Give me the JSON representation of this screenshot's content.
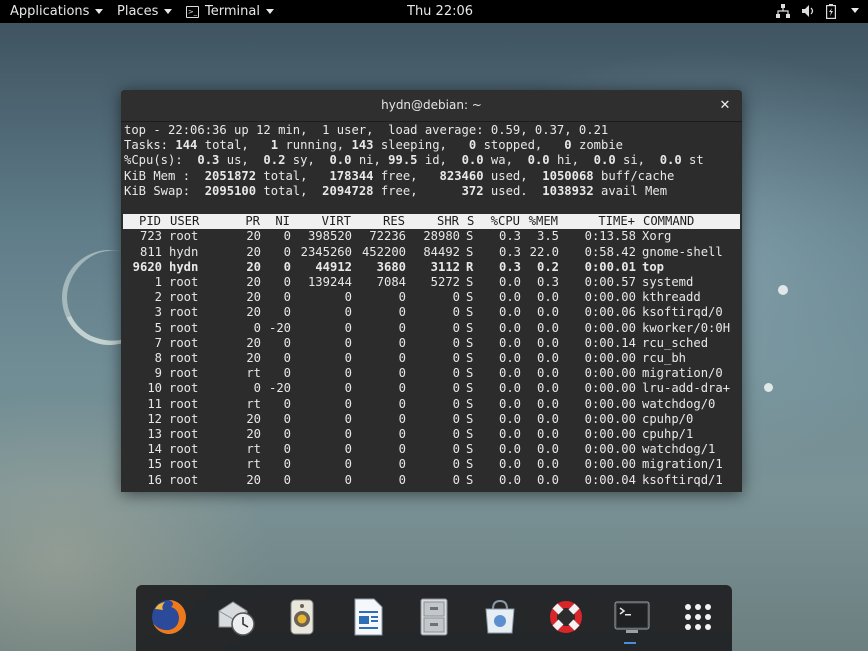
{
  "topbar": {
    "applications": "Applications",
    "places": "Places",
    "terminal": "Terminal",
    "clock": "Thu 22:06"
  },
  "window": {
    "title": "hydn@debian: ~"
  },
  "top": {
    "summary": [
      [
        {
          "t": "top - 22:06:36 up 12 min,  1 user,  load average: 0.59, 0.37, 0.21",
          "b": false
        }
      ],
      [
        {
          "t": "Tasks: ",
          "b": false
        },
        {
          "t": "144",
          "b": true
        },
        {
          "t": " total,   ",
          "b": false
        },
        {
          "t": "1",
          "b": true
        },
        {
          "t": " running, ",
          "b": false
        },
        {
          "t": "143",
          "b": true
        },
        {
          "t": " sleeping,   ",
          "b": false
        },
        {
          "t": "0",
          "b": true
        },
        {
          "t": " stopped,   ",
          "b": false
        },
        {
          "t": "0",
          "b": true
        },
        {
          "t": " zombie",
          "b": false
        }
      ],
      [
        {
          "t": "%Cpu(s):  ",
          "b": false
        },
        {
          "t": "0.3",
          "b": true
        },
        {
          "t": " us,  ",
          "b": false
        },
        {
          "t": "0.2",
          "b": true
        },
        {
          "t": " sy,  ",
          "b": false
        },
        {
          "t": "0.0",
          "b": true
        },
        {
          "t": " ni, ",
          "b": false
        },
        {
          "t": "99.5",
          "b": true
        },
        {
          "t": " id,  ",
          "b": false
        },
        {
          "t": "0.0",
          "b": true
        },
        {
          "t": " wa,  ",
          "b": false
        },
        {
          "t": "0.0",
          "b": true
        },
        {
          "t": " hi,  ",
          "b": false
        },
        {
          "t": "0.0",
          "b": true
        },
        {
          "t": " si,  ",
          "b": false
        },
        {
          "t": "0.0",
          "b": true
        },
        {
          "t": " st",
          "b": false
        }
      ],
      [
        {
          "t": "KiB Mem :  ",
          "b": false
        },
        {
          "t": "2051872",
          "b": true
        },
        {
          "t": " total,   ",
          "b": false
        },
        {
          "t": "178344",
          "b": true
        },
        {
          "t": " free,   ",
          "b": false
        },
        {
          "t": "823460",
          "b": true
        },
        {
          "t": " used,  ",
          "b": false
        },
        {
          "t": "1050068",
          "b": true
        },
        {
          "t": " buff/cache",
          "b": false
        }
      ],
      [
        {
          "t": "KiB Swap:  ",
          "b": false
        },
        {
          "t": "2095100",
          "b": true
        },
        {
          "t": " total,  ",
          "b": false
        },
        {
          "t": "2094728",
          "b": true
        },
        {
          "t": " free,      ",
          "b": false
        },
        {
          "t": "372",
          "b": true
        },
        {
          "t": " used.  ",
          "b": false
        },
        {
          "t": "1038932",
          "b": true
        },
        {
          "t": " avail Mem",
          "b": false
        }
      ]
    ],
    "columns": [
      "PID",
      "USER",
      "PR",
      "NI",
      "VIRT",
      "RES",
      "SHR",
      "S",
      "%CPU",
      "%MEM",
      "TIME+",
      "COMMAND"
    ],
    "processes": [
      {
        "pid": "723",
        "user": "root",
        "pr": "20",
        "ni": "0",
        "virt": "398520",
        "res": "72236",
        "shr": "28980",
        "s": "S",
        "cpu": "0.3",
        "mem": "3.5",
        "time": "0:13.58",
        "cmd": "Xorg",
        "bold": false
      },
      {
        "pid": "811",
        "user": "hydn",
        "pr": "20",
        "ni": "0",
        "virt": "2345260",
        "res": "452200",
        "shr": "84492",
        "s": "S",
        "cpu": "0.3",
        "mem": "22.0",
        "time": "0:58.42",
        "cmd": "gnome-shell",
        "bold": false
      },
      {
        "pid": "9620",
        "user": "hydn",
        "pr": "20",
        "ni": "0",
        "virt": "44912",
        "res": "3680",
        "shr": "3112",
        "s": "R",
        "cpu": "0.3",
        "mem": "0.2",
        "time": "0:00.01",
        "cmd": "top",
        "bold": true
      },
      {
        "pid": "1",
        "user": "root",
        "pr": "20",
        "ni": "0",
        "virt": "139244",
        "res": "7084",
        "shr": "5272",
        "s": "S",
        "cpu": "0.0",
        "mem": "0.3",
        "time": "0:00.57",
        "cmd": "systemd",
        "bold": false
      },
      {
        "pid": "2",
        "user": "root",
        "pr": "20",
        "ni": "0",
        "virt": "0",
        "res": "0",
        "shr": "0",
        "s": "S",
        "cpu": "0.0",
        "mem": "0.0",
        "time": "0:00.00",
        "cmd": "kthreadd",
        "bold": false
      },
      {
        "pid": "3",
        "user": "root",
        "pr": "20",
        "ni": "0",
        "virt": "0",
        "res": "0",
        "shr": "0",
        "s": "S",
        "cpu": "0.0",
        "mem": "0.0",
        "time": "0:00.06",
        "cmd": "ksoftirqd/0",
        "bold": false
      },
      {
        "pid": "5",
        "user": "root",
        "pr": "0",
        "ni": "-20",
        "virt": "0",
        "res": "0",
        "shr": "0",
        "s": "S",
        "cpu": "0.0",
        "mem": "0.0",
        "time": "0:00.00",
        "cmd": "kworker/0:0H",
        "bold": false
      },
      {
        "pid": "7",
        "user": "root",
        "pr": "20",
        "ni": "0",
        "virt": "0",
        "res": "0",
        "shr": "0",
        "s": "S",
        "cpu": "0.0",
        "mem": "0.0",
        "time": "0:00.14",
        "cmd": "rcu_sched",
        "bold": false
      },
      {
        "pid": "8",
        "user": "root",
        "pr": "20",
        "ni": "0",
        "virt": "0",
        "res": "0",
        "shr": "0",
        "s": "S",
        "cpu": "0.0",
        "mem": "0.0",
        "time": "0:00.00",
        "cmd": "rcu_bh",
        "bold": false
      },
      {
        "pid": "9",
        "user": "root",
        "pr": "rt",
        "ni": "0",
        "virt": "0",
        "res": "0",
        "shr": "0",
        "s": "S",
        "cpu": "0.0",
        "mem": "0.0",
        "time": "0:00.00",
        "cmd": "migration/0",
        "bold": false
      },
      {
        "pid": "10",
        "user": "root",
        "pr": "0",
        "ni": "-20",
        "virt": "0",
        "res": "0",
        "shr": "0",
        "s": "S",
        "cpu": "0.0",
        "mem": "0.0",
        "time": "0:00.00",
        "cmd": "lru-add-dra+",
        "bold": false
      },
      {
        "pid": "11",
        "user": "root",
        "pr": "rt",
        "ni": "0",
        "virt": "0",
        "res": "0",
        "shr": "0",
        "s": "S",
        "cpu": "0.0",
        "mem": "0.0",
        "time": "0:00.00",
        "cmd": "watchdog/0",
        "bold": false
      },
      {
        "pid": "12",
        "user": "root",
        "pr": "20",
        "ni": "0",
        "virt": "0",
        "res": "0",
        "shr": "0",
        "s": "S",
        "cpu": "0.0",
        "mem": "0.0",
        "time": "0:00.00",
        "cmd": "cpuhp/0",
        "bold": false
      },
      {
        "pid": "13",
        "user": "root",
        "pr": "20",
        "ni": "0",
        "virt": "0",
        "res": "0",
        "shr": "0",
        "s": "S",
        "cpu": "0.0",
        "mem": "0.0",
        "time": "0:00.00",
        "cmd": "cpuhp/1",
        "bold": false
      },
      {
        "pid": "14",
        "user": "root",
        "pr": "rt",
        "ni": "0",
        "virt": "0",
        "res": "0",
        "shr": "0",
        "s": "S",
        "cpu": "0.0",
        "mem": "0.0",
        "time": "0:00.00",
        "cmd": "watchdog/1",
        "bold": false
      },
      {
        "pid": "15",
        "user": "root",
        "pr": "rt",
        "ni": "0",
        "virt": "0",
        "res": "0",
        "shr": "0",
        "s": "S",
        "cpu": "0.0",
        "mem": "0.0",
        "time": "0:00.00",
        "cmd": "migration/1",
        "bold": false
      },
      {
        "pid": "16",
        "user": "root",
        "pr": "20",
        "ni": "0",
        "virt": "0",
        "res": "0",
        "shr": "0",
        "s": "S",
        "cpu": "0.0",
        "mem": "0.0",
        "time": "0:00.04",
        "cmd": "ksoftirqd/1",
        "bold": false
      }
    ]
  },
  "dock": {
    "items": [
      {
        "name": "firefox-icon"
      },
      {
        "name": "evolution-icon"
      },
      {
        "name": "rhythmbox-icon"
      },
      {
        "name": "libreoffice-writer-icon"
      },
      {
        "name": "files-icon"
      },
      {
        "name": "software-icon"
      },
      {
        "name": "help-icon"
      },
      {
        "name": "terminal-icon"
      },
      {
        "name": "show-applications-icon"
      }
    ]
  },
  "colors": {
    "terminal_bg": "#2c2c2c",
    "header_bg": "#f0f0f0",
    "running_indicator": "#4a90d9"
  }
}
